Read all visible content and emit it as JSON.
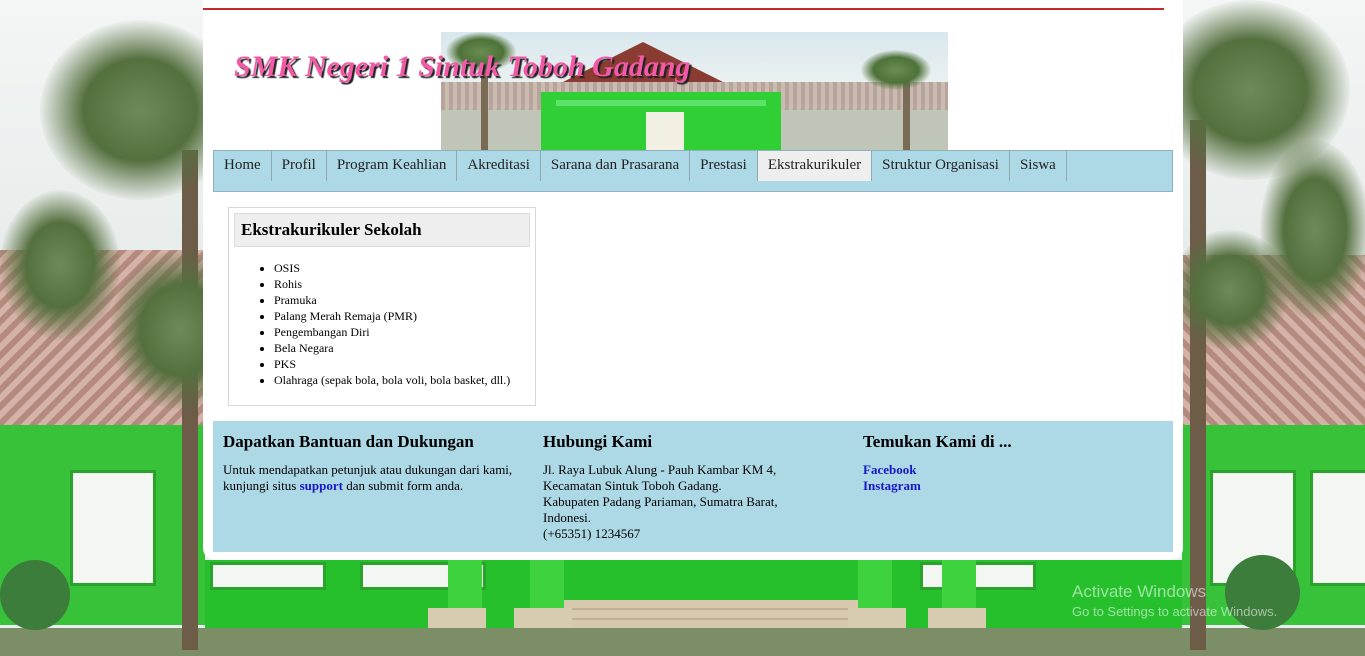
{
  "header": {
    "school_name": "SMK Negeri 1 Sintuk Toboh Gadang"
  },
  "nav": {
    "items": [
      "Home",
      "Profil",
      "Program Keahlian",
      "Akreditasi",
      "Sarana dan Prasarana",
      "Prestasi",
      "Ekstrakurikuler",
      "Struktur Organisasi",
      "Siswa"
    ],
    "active": "Ekstrakurikuler"
  },
  "ekstrakurikuler": {
    "title": "Ekstrakurikuler Sekolah",
    "items": [
      "OSIS",
      "Rohis",
      "Pramuka",
      "Palang Merah Remaja (PMR)",
      "Pengembangan Diri",
      "Bela Negara",
      "PKS",
      "Olahraga (sepak bola, bola voli, bola basket, dll.)"
    ]
  },
  "footer": {
    "help": {
      "title": "Dapatkan Bantuan dan Dukungan",
      "text_before": "Untuk mendapatkan petunjuk atau dukungan dari kami, kunjungi situs ",
      "link": "support",
      "text_after": " dan submit form anda."
    },
    "contact": {
      "title": "Hubungi Kami",
      "lines": [
        "Jl. Raya Lubuk Alung - Pauh Kambar KM 4,",
        "Kecamatan Sintuk Toboh Gadang.",
        "Kabupaten Padang Pariaman, Sumatra Barat,",
        "Indonesi.",
        "(+65351) 1234567"
      ]
    },
    "social": {
      "title": "Temukan Kami di ...",
      "links": [
        "Facebook",
        "Instagram"
      ]
    }
  },
  "watermark": {
    "title": "Activate Windows",
    "subtitle": "Go to Settings to activate Windows."
  },
  "colors": {
    "nav_bg": "#add8e6",
    "footer_bg": "#add8e6",
    "title_pink": "#f25aa7",
    "link_blue": "#1818c8",
    "rule_red": "#c52a2a"
  }
}
